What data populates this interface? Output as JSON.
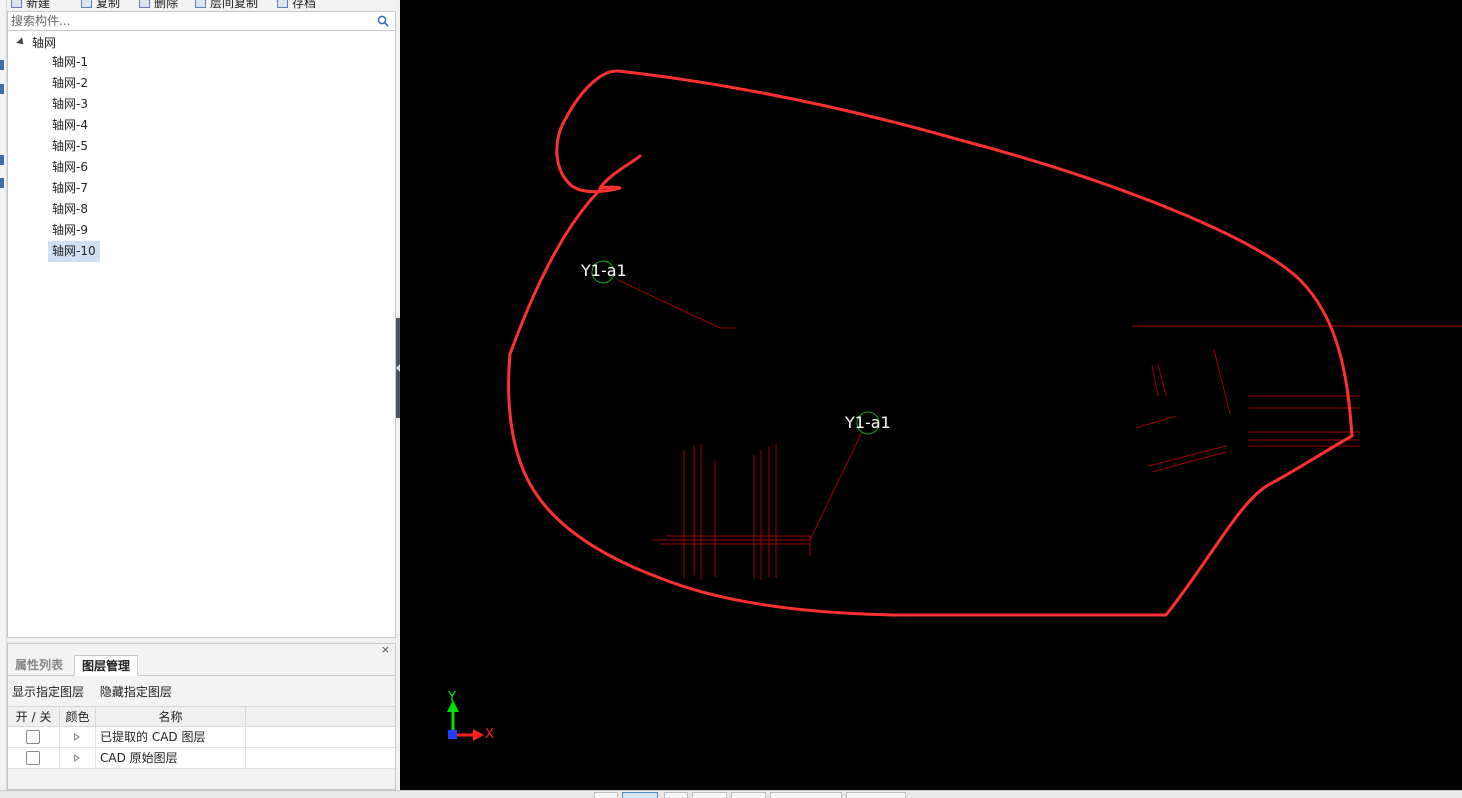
{
  "toolbar": {
    "items": [
      "新建",
      "复制",
      "删除",
      "层间复制",
      "存档"
    ]
  },
  "search": {
    "placeholder": "搜索构件..."
  },
  "tree": {
    "root": "轴网",
    "items": [
      "轴网-1",
      "轴网-2",
      "轴网-3",
      "轴网-4",
      "轴网-5",
      "轴网-6",
      "轴网-7",
      "轴网-8",
      "轴网-9",
      "轴网-10"
    ],
    "selected": "轴网-10"
  },
  "panel": {
    "close": "×",
    "tabs": [
      "属性列表",
      "图层管理"
    ],
    "active_tab": "图层管理",
    "actions": [
      "显示指定图层",
      "隐藏指定图层"
    ],
    "columns": [
      "开 / 关",
      "颜色",
      "名称"
    ],
    "rows": [
      {
        "name": "已提取的 CAD 图层",
        "checked": false
      },
      {
        "name": "CAD 原始图层",
        "checked": false
      }
    ]
  },
  "canvas": {
    "background": "#000000",
    "labels": [
      "Y1-a1",
      "Y1-a1"
    ],
    "axis_x": "X",
    "axis_y": "Y",
    "annotation_color": "#ff3030",
    "cad_line_color": "#a00000"
  }
}
